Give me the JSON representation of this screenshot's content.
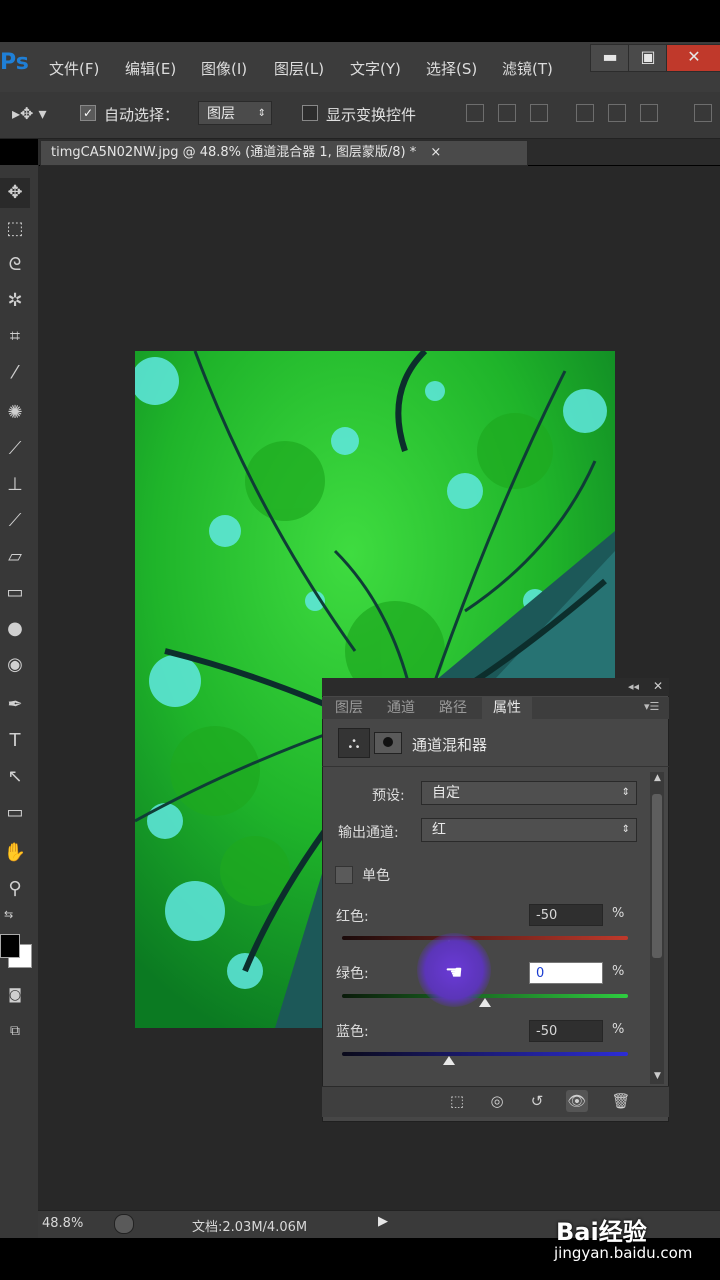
{
  "app": {
    "logo": "Ps"
  },
  "menu": [
    "文件(F)",
    "编辑(E)",
    "图像(I)",
    "图层(L)",
    "文字(Y)",
    "选择(S)",
    "滤镜(T)"
  ],
  "window_buttons": {
    "minimize": "▬",
    "maximize": "▣",
    "close": "✕"
  },
  "options": {
    "auto_select_label": "自动选择：",
    "auto_select_value": "图层",
    "show_transform_label": "显示变换控件"
  },
  "document": {
    "tab_title": "timgCA5N02NW.jpg @ 48.8% (通道混合器 1, 图层蒙版/8) *",
    "close": "×"
  },
  "status": {
    "zoom": "48.8%",
    "doc_info": "文档:2.03M/4.06M"
  },
  "panel": {
    "tabs": [
      "图层",
      "通道",
      "路径",
      "属性"
    ],
    "active_tab": 3,
    "title": "通道混和器",
    "preset_label": "预设:",
    "preset_value": "自定",
    "output_label": "输出通道:",
    "output_value": "红",
    "mono_label": "单色",
    "channels": [
      {
        "label": "红色:",
        "value": "-50",
        "unit": "%",
        "track_color": "#c0392b",
        "level": -50
      },
      {
        "label": "绿色:",
        "value": "0",
        "unit": "%",
        "track_color": "#2ecc40",
        "level": 0
      },
      {
        "label": "蓝色:",
        "value": "-50",
        "unit": "%",
        "track_color": "#2d2dd6",
        "level": -50
      }
    ]
  },
  "watermark": {
    "brand": "Bai经验",
    "url": "jingyan.baidu.com"
  },
  "colors": {
    "accent_logo": "#1f7fd6",
    "panel_bg": "#474747",
    "canvas_bg": "#282828"
  }
}
